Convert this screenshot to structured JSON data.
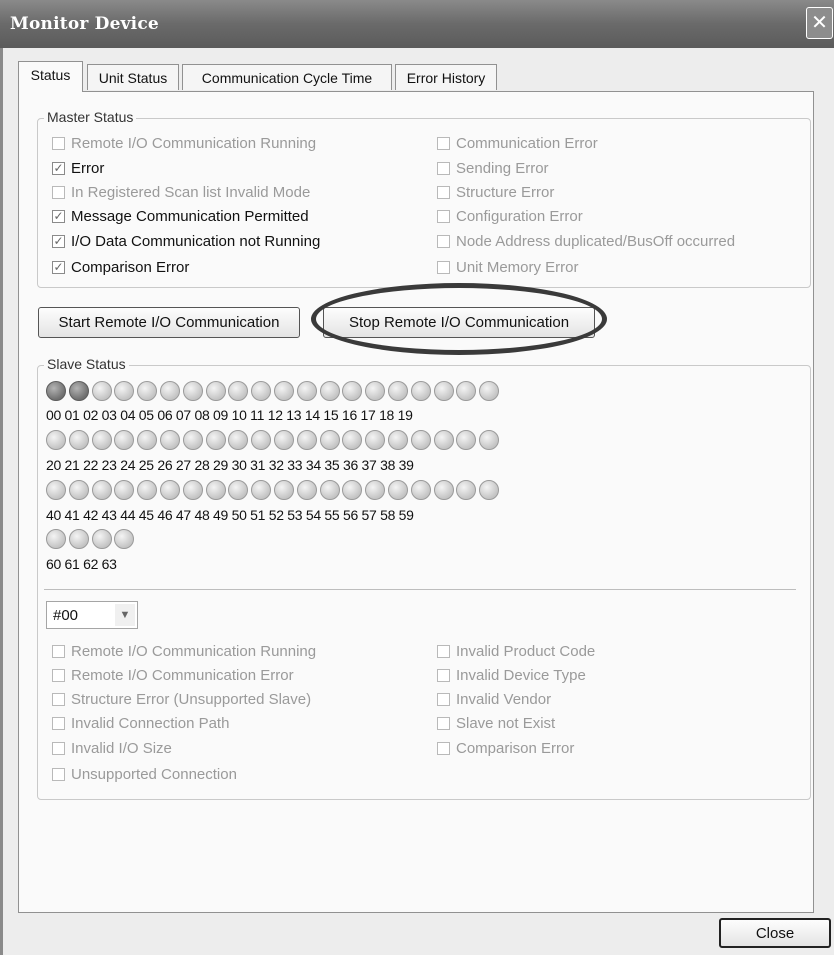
{
  "window": {
    "title": "Monitor Device",
    "close_glyph": "✕"
  },
  "tabs": [
    {
      "label": "Status"
    },
    {
      "label": "Unit Status"
    },
    {
      "label": "Communication Cycle Time"
    },
    {
      "label": "Error History"
    }
  ],
  "master_status": {
    "legend": "Master Status",
    "items": [
      {
        "label": "Remote I/O Communication Running",
        "checked": false
      },
      {
        "label": "Error",
        "checked": true
      },
      {
        "label": "In Registered Scan list Invalid Mode",
        "checked": false
      },
      {
        "label": "Message Communication Permitted",
        "checked": true
      },
      {
        "label": "I/O Data Communication not Running",
        "checked": true
      },
      {
        "label": "Comparison Error",
        "checked": true
      },
      {
        "label": "Communication Error",
        "checked": false
      },
      {
        "label": "Sending Error",
        "checked": false
      },
      {
        "label": "Structure Error",
        "checked": false
      },
      {
        "label": "Configuration Error",
        "checked": false
      },
      {
        "label": "Node Address duplicated/BusOff occurred",
        "checked": false
      },
      {
        "label": "Unit Memory Error",
        "checked": false
      }
    ]
  },
  "buttons": {
    "start_remote_io": "Start Remote I/O Communication",
    "stop_remote_io": "Stop Remote I/O Communication",
    "close": "Close"
  },
  "slave_status": {
    "legend": "Slave Status",
    "rows": [
      "00 01 02 03 04 05 06 07 08 09 10 11 12 13 14 15 16 17 18 19",
      "20 21 22 23 24 25 26 27 28 29 30 31 32 33 34 35 36 37 38 39",
      "40 41 42 43 44 45 46 47 48 49 50 51 52 53 54 55 56 57 58 59",
      "60 61 62 63"
    ],
    "active_nodes": [
      "00",
      "01"
    ],
    "selected_node": "#00",
    "items": [
      {
        "label": "Remote I/O Communication Running",
        "checked": false
      },
      {
        "label": "Remote I/O Communication Error",
        "checked": false
      },
      {
        "label": "Structure Error (Unsupported Slave)",
        "checked": false
      },
      {
        "label": "Invalid Connection Path",
        "checked": false
      },
      {
        "label": "Invalid I/O Size",
        "checked": false
      },
      {
        "label": "Unsupported Connection",
        "checked": false
      },
      {
        "label": "Invalid Product Code",
        "checked": false
      },
      {
        "label": "Invalid Device Type",
        "checked": false
      },
      {
        "label": "Invalid Vendor",
        "checked": false
      },
      {
        "label": "Slave not Exist",
        "checked": false
      },
      {
        "label": "Comparison Error",
        "checked": false
      }
    ]
  },
  "colors": {
    "titlebar": "#6a6a6a",
    "panel": "#fafafa",
    "annotation_ellipse": "#3a3a3a"
  }
}
